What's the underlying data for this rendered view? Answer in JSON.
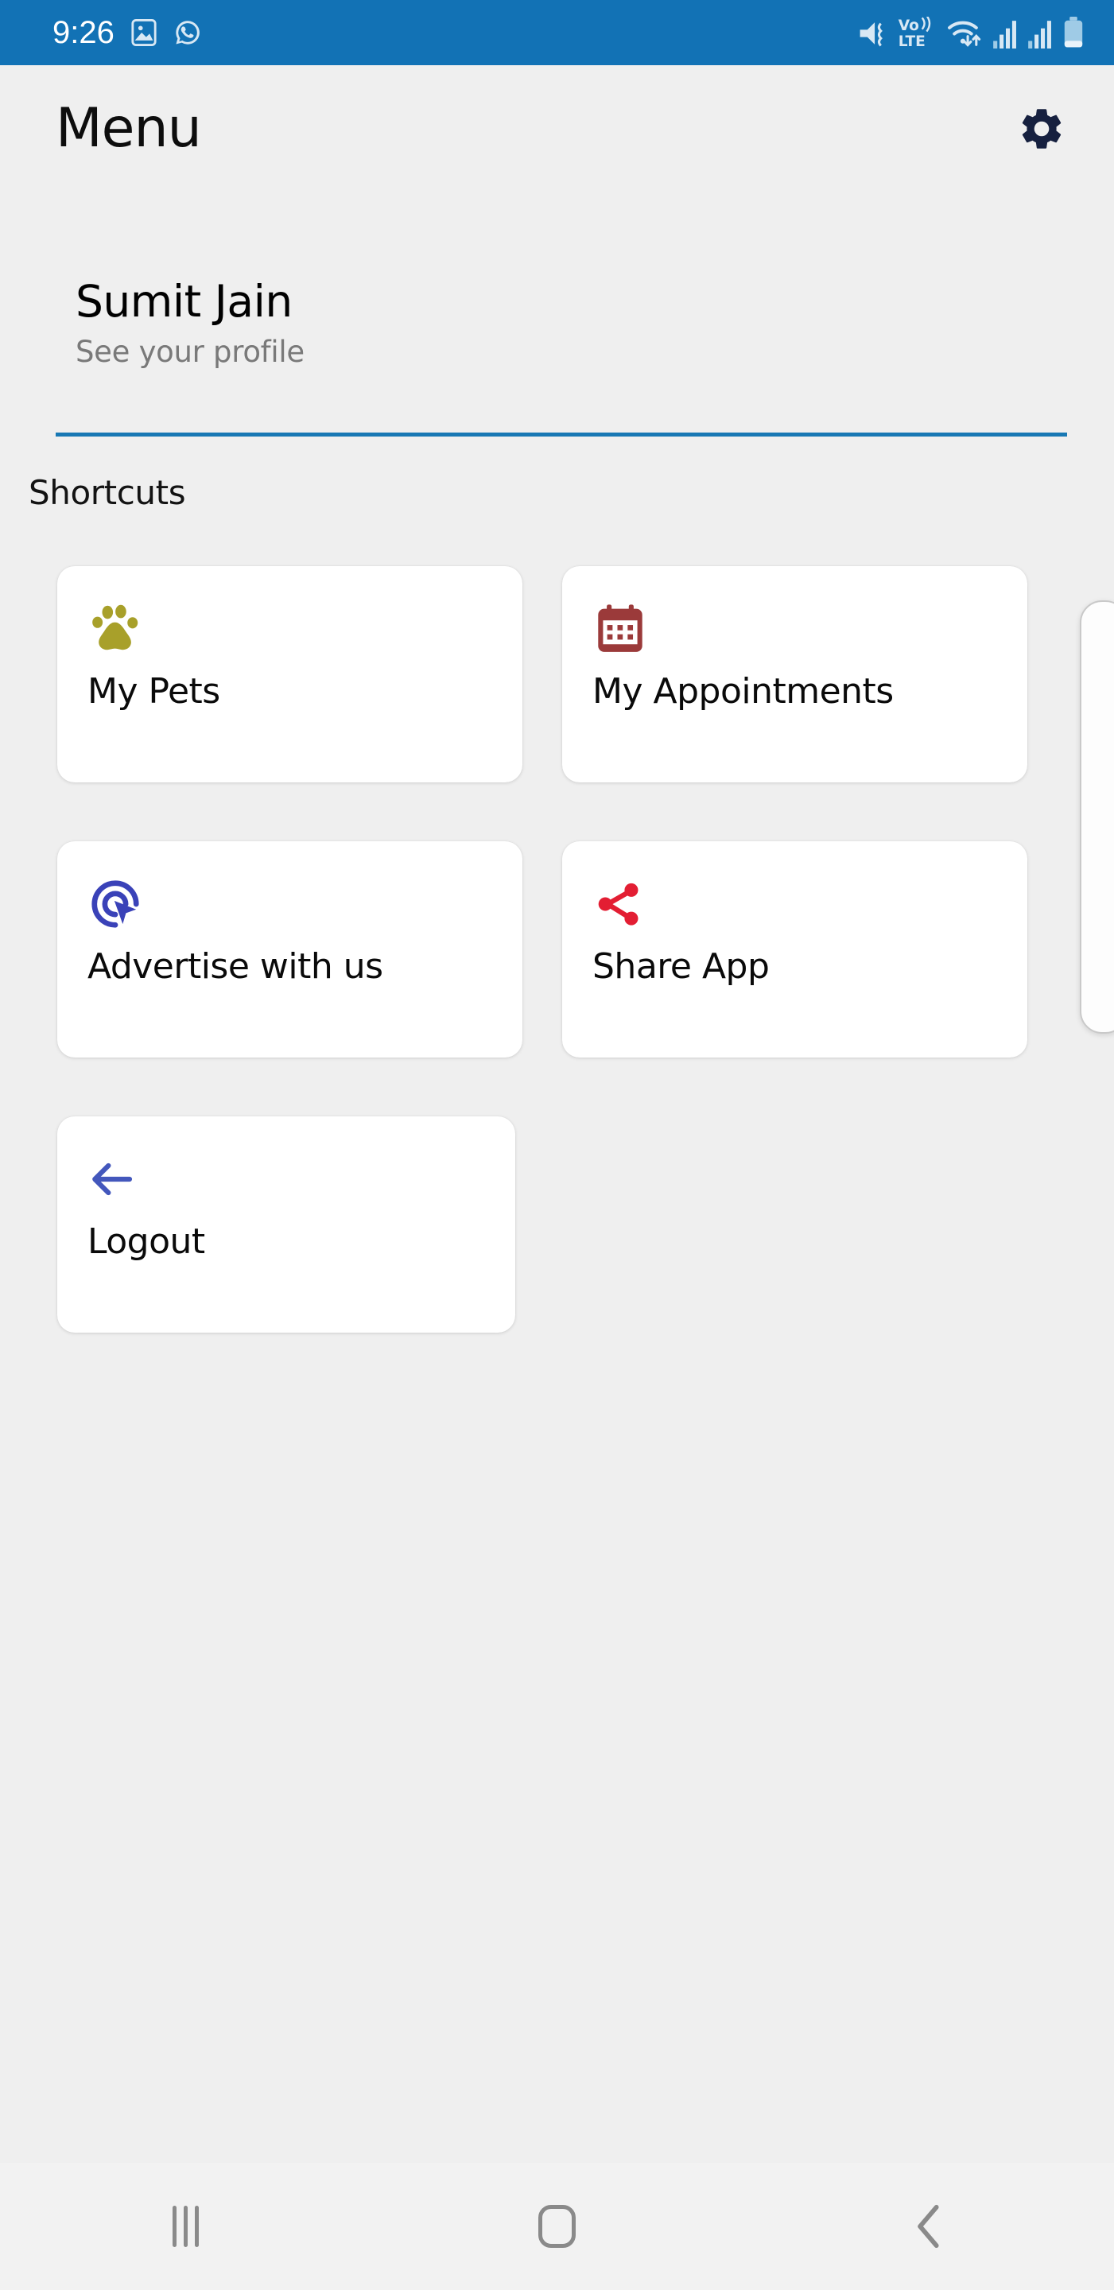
{
  "status_bar": {
    "time": "9:26",
    "background_color": "#1272B5",
    "left_icons": [
      "gallery-icon",
      "whatsapp-icon"
    ],
    "right_icons": [
      "vibrate-icon",
      "volte-icon",
      "wifi-icon",
      "signal-sim1-icon",
      "signal-sim2-icon",
      "battery-icon"
    ],
    "network_label_top": "Vo))",
    "network_label_bottom": "LTE"
  },
  "app_bar": {
    "title": "Menu",
    "settings_icon": "gear-icon",
    "settings_color": "#16203F"
  },
  "profile": {
    "name": "Sumit Jain",
    "subtitle": "See your profile",
    "divider_color": "#1878B4"
  },
  "shortcuts": {
    "section_label": "Shortcuts",
    "rows": [
      [
        {
          "label": "My Pets",
          "icon": "paw-icon",
          "color": "#A8A02A"
        },
        {
          "label": "My Appointments",
          "icon": "calendar-icon",
          "color": "#9B3A3A"
        }
      ],
      [
        {
          "label": "Advertise with us",
          "icon": "ad-click-target-icon",
          "color": "#3A42B8"
        },
        {
          "label": "Share App",
          "icon": "share-icon",
          "color": "#E31E33"
        }
      ],
      [
        {
          "label": "Logout",
          "icon": "arrow-left-icon",
          "color": "#4357BC"
        }
      ]
    ]
  },
  "nav_bar": {
    "recents_label": "recents-icon",
    "home_label": "home-icon",
    "back_label": "back-icon",
    "icon_color": "#8A8A8A"
  },
  "edge_panel": {
    "label": "edge-panel-handle"
  },
  "theme": {
    "background": "#EFEFEF",
    "card_background": "#FFFFFF",
    "text_primary": "#0A0A0A",
    "text_secondary": "#797979"
  }
}
